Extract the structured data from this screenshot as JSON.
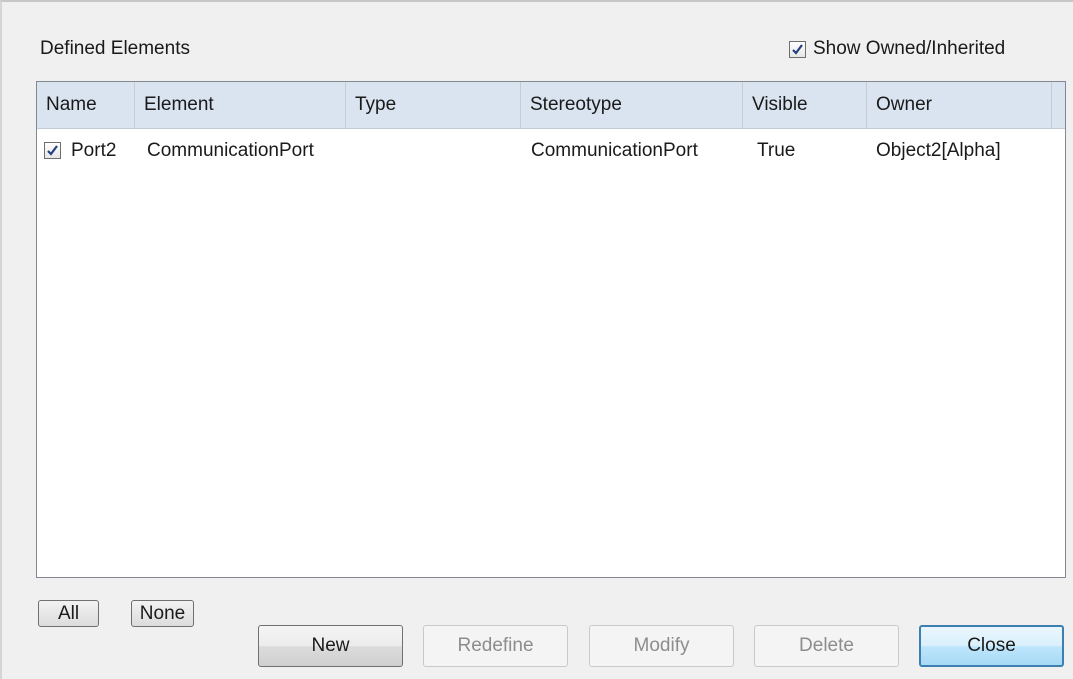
{
  "dialog": {
    "section_label": "Defined Elements",
    "show_owned_label": "Show Owned/Inherited",
    "show_owned_checked": true
  },
  "list": {
    "columns": [
      "Name",
      "Element",
      "Type",
      "Stereotype",
      "Visible",
      "Owner"
    ],
    "rows": [
      {
        "checked": true,
        "name": "Port2",
        "element": "CommunicationPort",
        "type": "",
        "stereotype": "CommunicationPort",
        "visible": "True",
        "owner": "Object2[Alpha]"
      }
    ]
  },
  "selection_buttons": {
    "all": "All",
    "none": "None"
  },
  "buttons": {
    "new": "New",
    "redefine": "Redefine",
    "modify": "Modify",
    "delete": "Delete",
    "close": "Close"
  },
  "states": {
    "redefine_enabled": false,
    "modify_enabled": false,
    "delete_enabled": false,
    "default_button": "close"
  },
  "icons": {
    "check": "checkmark-icon"
  },
  "colors": {
    "header_bg": "#d9e4f0",
    "check_color": "#21407e",
    "default_button_border": "#3c7fb1"
  }
}
